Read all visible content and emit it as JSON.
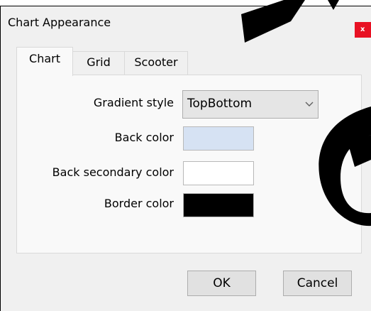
{
  "window": {
    "title": "Chart Appearance",
    "close_glyph": "x",
    "close_icon": "close-icon"
  },
  "tabs": [
    {
      "label": "Chart",
      "active": true
    },
    {
      "label": "Grid",
      "active": false
    },
    {
      "label": "Scooter",
      "active": false
    }
  ],
  "form": {
    "gradient_style": {
      "label": "Gradient style",
      "value": "TopBottom",
      "icon": "chevron-down-icon"
    },
    "back_color": {
      "label": "Back color",
      "color": "#d6e2f3"
    },
    "back_secondary_color": {
      "label": "Back secondary color",
      "color": "#ffffff"
    },
    "border_color": {
      "label": "Border color",
      "color": "#000000"
    }
  },
  "buttons": {
    "ok_label": "OK",
    "cancel_label": "Cancel"
  },
  "colors": {
    "close_button": "#e81123",
    "watermark": "#000000"
  }
}
